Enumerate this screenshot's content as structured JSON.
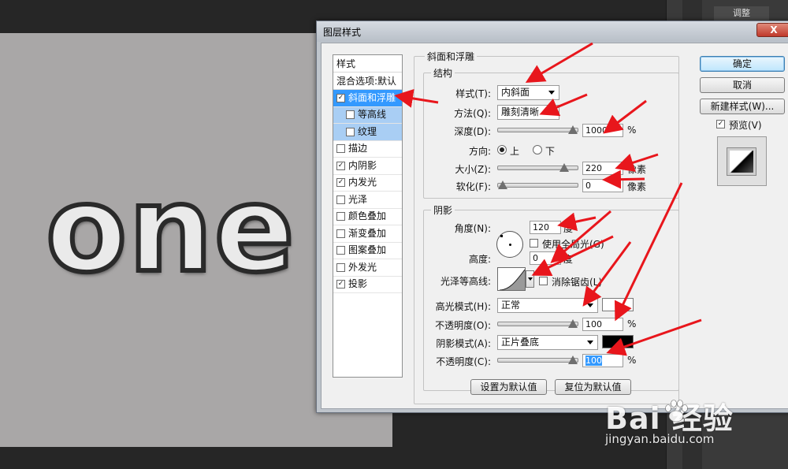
{
  "canvas": {
    "text": "one"
  },
  "right_panel": {
    "tab": "调整"
  },
  "dialog": {
    "title": "图层样式",
    "close_symbol": "X",
    "styles_list": {
      "header": "样式",
      "blend_options": "混合选项:默认",
      "items": [
        {
          "label": "斜面和浮雕",
          "checked": true,
          "selected": true
        },
        {
          "label": "等高线",
          "checked": false,
          "sub": true
        },
        {
          "label": "纹理",
          "checked": false,
          "sub": true
        },
        {
          "label": "描边",
          "checked": false
        },
        {
          "label": "内阴影",
          "checked": true
        },
        {
          "label": "内发光",
          "checked": true
        },
        {
          "label": "光泽",
          "checked": false
        },
        {
          "label": "颜色叠加",
          "checked": false
        },
        {
          "label": "渐变叠加",
          "checked": false
        },
        {
          "label": "图案叠加",
          "checked": false
        },
        {
          "label": "外发光",
          "checked": false
        },
        {
          "label": "投影",
          "checked": true
        }
      ]
    },
    "bevel": {
      "group_title": "斜面和浮雕",
      "structure": {
        "title": "结构",
        "style_label": "样式(T):",
        "style_value": "内斜面",
        "technique_label": "方法(Q):",
        "technique_value": "雕刻清晰",
        "depth_label": "深度(D):",
        "depth_value": "1000",
        "depth_unit": "%",
        "depth_fraction": 1.0,
        "direction_label": "方向:",
        "dir_up": "上",
        "dir_down": "下",
        "direction_selected": "上",
        "size_label": "大小(Z):",
        "size_value": "220",
        "size_unit": "像素",
        "size_fraction": 0.88,
        "soften_label": "软化(F):",
        "soften_value": "0",
        "soften_unit": "像素",
        "soften_fraction": 0.0
      },
      "shading": {
        "title": "阴影",
        "angle_label": "角度(N):",
        "angle_value": "120",
        "angle_unit": "度",
        "global_light_label": "使用全局光(G)",
        "global_light_checked": false,
        "altitude_label": "高度:",
        "altitude_value": "0",
        "altitude_unit": "度",
        "gloss_label": "光泽等高线:",
        "antialias_label": "消除锯齿(L)",
        "antialias_checked": false,
        "highlight_mode_label": "高光模式(H):",
        "highlight_mode_value": "正常",
        "highlight_color": "#ffffff",
        "highlight_opacity_label": "不透明度(O):",
        "highlight_opacity_value": "100",
        "highlight_opacity_unit": "%",
        "highlight_opacity_fraction": 1.0,
        "shadow_mode_label": "阴影模式(A):",
        "shadow_mode_value": "正片叠底",
        "shadow_color": "#000000",
        "shadow_opacity_label": "不透明度(C):",
        "shadow_opacity_value": "100",
        "shadow_opacity_unit": "%",
        "shadow_opacity_fraction": 1.0
      },
      "make_default": "设置为默认值",
      "reset_default": "复位为默认值"
    },
    "buttons": {
      "ok": "确定",
      "cancel": "取消",
      "new_style": "新建样式(W)...",
      "preview_label": "预览(V)",
      "preview_checked": true
    }
  },
  "watermark": {
    "brand": "Bai  经验",
    "url": "jingyan.baidu.com"
  },
  "colors": {
    "selection": "#3399ff",
    "arrow": "#e8161c"
  }
}
